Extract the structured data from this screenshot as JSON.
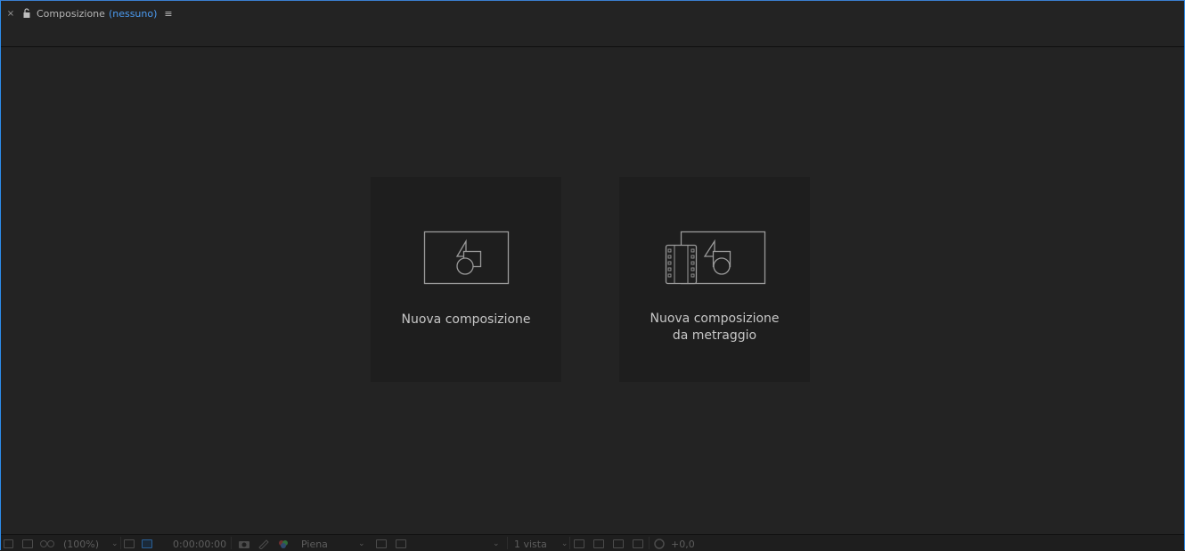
{
  "panel": {
    "close_glyph": "×",
    "title": "Composizione",
    "subtitle": "(nessuno)",
    "menu_glyph": "≡"
  },
  "cards": [
    {
      "label": "Nuova composizione"
    },
    {
      "label_line1": "Nuova composizione",
      "label_line2": "da metraggio"
    }
  ],
  "statusbar": {
    "zoom": "(100%)",
    "timecode": "0:00:00:00",
    "resolution": "Piena",
    "views": "1 vista",
    "exposure": "+0,0"
  },
  "colors": {
    "background": "#232323",
    "card": "#1e1e1e",
    "accent": "#4c9cf2"
  }
}
